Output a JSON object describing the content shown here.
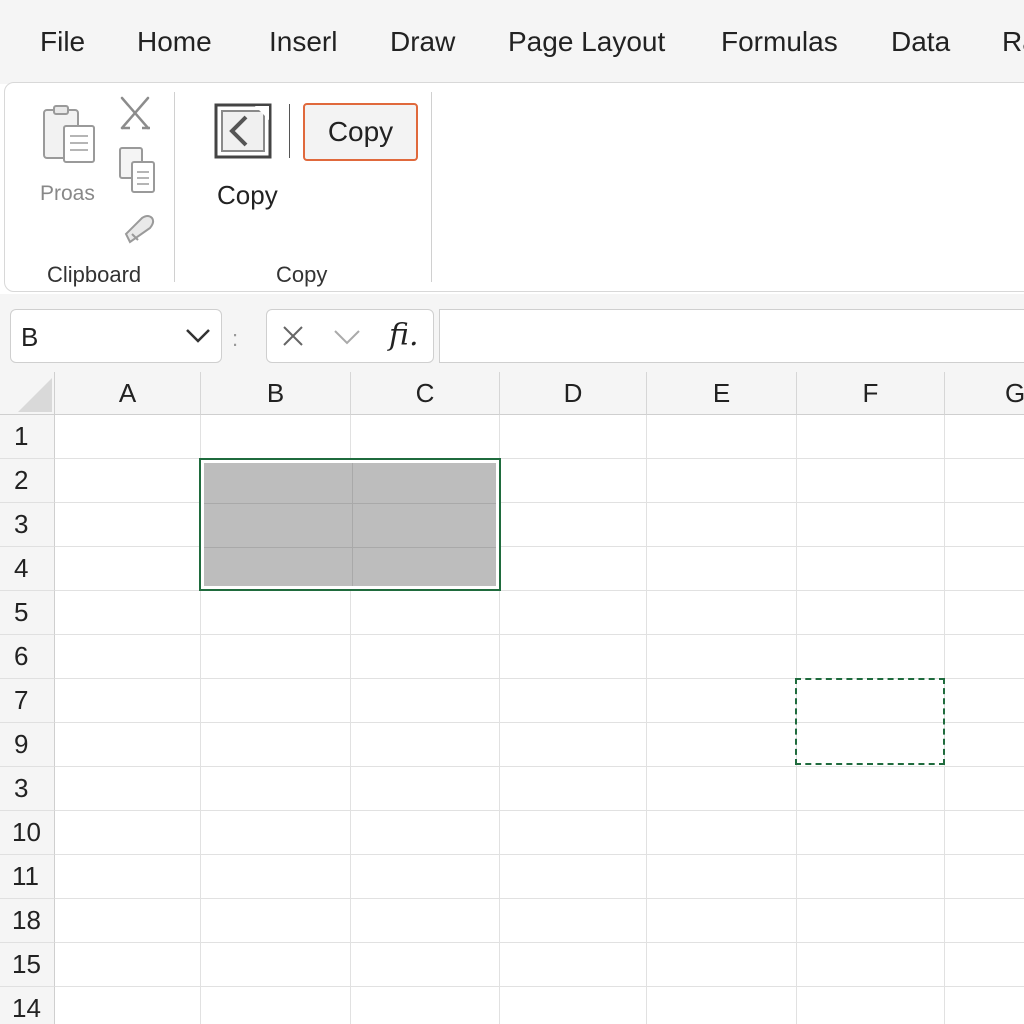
{
  "menu": {
    "tabs": [
      "File",
      "Home",
      "Inserl",
      "Draw",
      "Page Layout",
      "Formulas",
      "Data",
      "Ra"
    ]
  },
  "ribbon": {
    "clipboard": {
      "paste_label": "Proas",
      "group_label": "Clipboard",
      "icons": [
        "paste-icon",
        "cut-icon",
        "copy-icon",
        "format-painter-icon"
      ]
    },
    "copy_group": {
      "big_button_label": "Copy",
      "button_label": "Copy",
      "group_label": "Copy",
      "icons": [
        "copy-picture-icon"
      ]
    }
  },
  "formula_bar": {
    "name_box": "B",
    "separator": ":",
    "fx_label": "fi.",
    "formula_value": ""
  },
  "grid": {
    "columns": [
      "A",
      "B",
      "C",
      "D",
      "E",
      "F",
      "G"
    ],
    "rows": [
      "1",
      "2",
      "3",
      "4",
      "5",
      "6",
      "7",
      "9",
      "3",
      "10",
      "11",
      "18",
      "15",
      "14"
    ],
    "selection_range": "B2:C4",
    "marquee_range": "F7:F9"
  },
  "colors": {
    "selection_border": "#1f6b3d",
    "selection_fill": "#bdbdbd",
    "copy_button_border": "#e0693c"
  }
}
